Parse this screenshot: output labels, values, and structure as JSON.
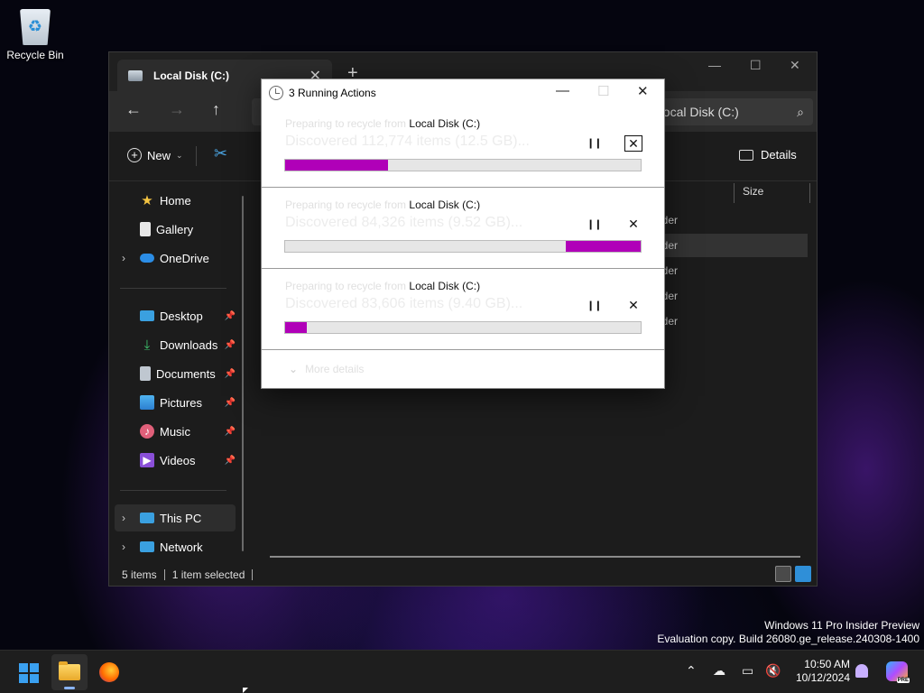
{
  "desktop": {
    "recycle_bin_label": "Recycle Bin"
  },
  "explorer": {
    "tab_title": "Local Disk (C:)",
    "address_path": "",
    "search_text": "Local Disk (C:)",
    "toolbar": {
      "new_label": "New",
      "details_label": "Details"
    },
    "nav": {
      "home": "Home",
      "gallery": "Gallery",
      "onedrive": "OneDrive",
      "desktop": "Desktop",
      "downloads": "Downloads",
      "documents": "Documents",
      "pictures": "Pictures",
      "music": "Music",
      "videos": "Videos",
      "this_pc": "This PC",
      "network": "Network"
    },
    "columns": {
      "size": "Size"
    },
    "rows": [
      "lder",
      "lder",
      "lder",
      "lder",
      "lder"
    ],
    "status": {
      "items": "5 items",
      "selected": "1 item selected"
    }
  },
  "dialog": {
    "title": "3 Running Actions",
    "operations": [
      {
        "prefix": "Preparing to recycle from ",
        "destination": "Local Disk (C:)",
        "detail": "Discovered 112,774 items (12.5 GB)...",
        "progress_start": 0,
        "progress_end": 0.29
      },
      {
        "prefix": "Preparing to recycle from ",
        "destination": "Local Disk (C:)",
        "detail": "Discovered 84,326 items (9.52 GB)...",
        "progress_start": 0.79,
        "progress_end": 1.0
      },
      {
        "prefix": "Preparing to recycle from ",
        "destination": "Local Disk (C:)",
        "detail": "Discovered 83,606 items (9.40 GB)...",
        "progress_start": 0,
        "progress_end": 0.06
      }
    ],
    "pause_icon": "pause-icon",
    "cancel_icon": "close-icon",
    "more_details": "More details",
    "accent_color": "#b000b8"
  },
  "watermark": {
    "line1": "Windows 11 Pro Insider Preview",
    "line2": "Evaluation copy. Build 26080.ge_release.240308-1400"
  },
  "taskbar": {
    "time": "10:50 AM",
    "date": "10/12/2024",
    "copilot_badge": "PRE"
  }
}
